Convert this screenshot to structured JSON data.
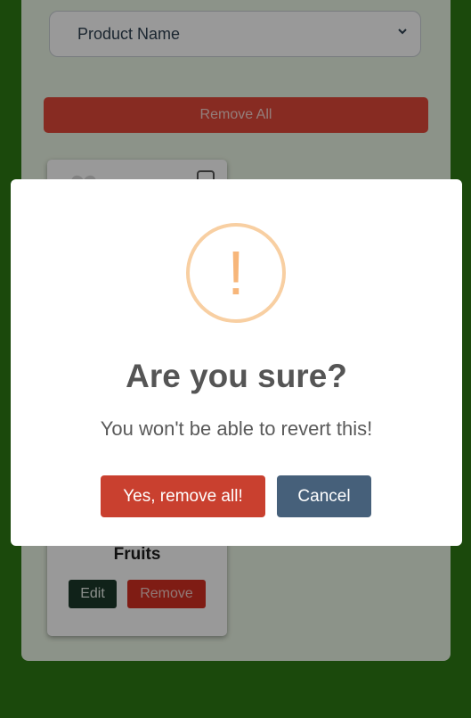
{
  "background": {
    "sort_select": {
      "selected_value": "Product Name"
    },
    "remove_all_label": "Remove All",
    "product_card": {
      "category": "Fruits",
      "edit_label": "Edit",
      "remove_label": "Remove"
    }
  },
  "dialog": {
    "icon_glyph": "!",
    "title": "Are you sure?",
    "text": "You won't be able to revert this!",
    "confirm_label": "Yes, remove all!",
    "cancel_label": "Cancel"
  },
  "colors": {
    "page_background": "#2d7a14",
    "danger": "#c9402f",
    "cancel": "#46607a",
    "warning": "#f8cfa2"
  }
}
